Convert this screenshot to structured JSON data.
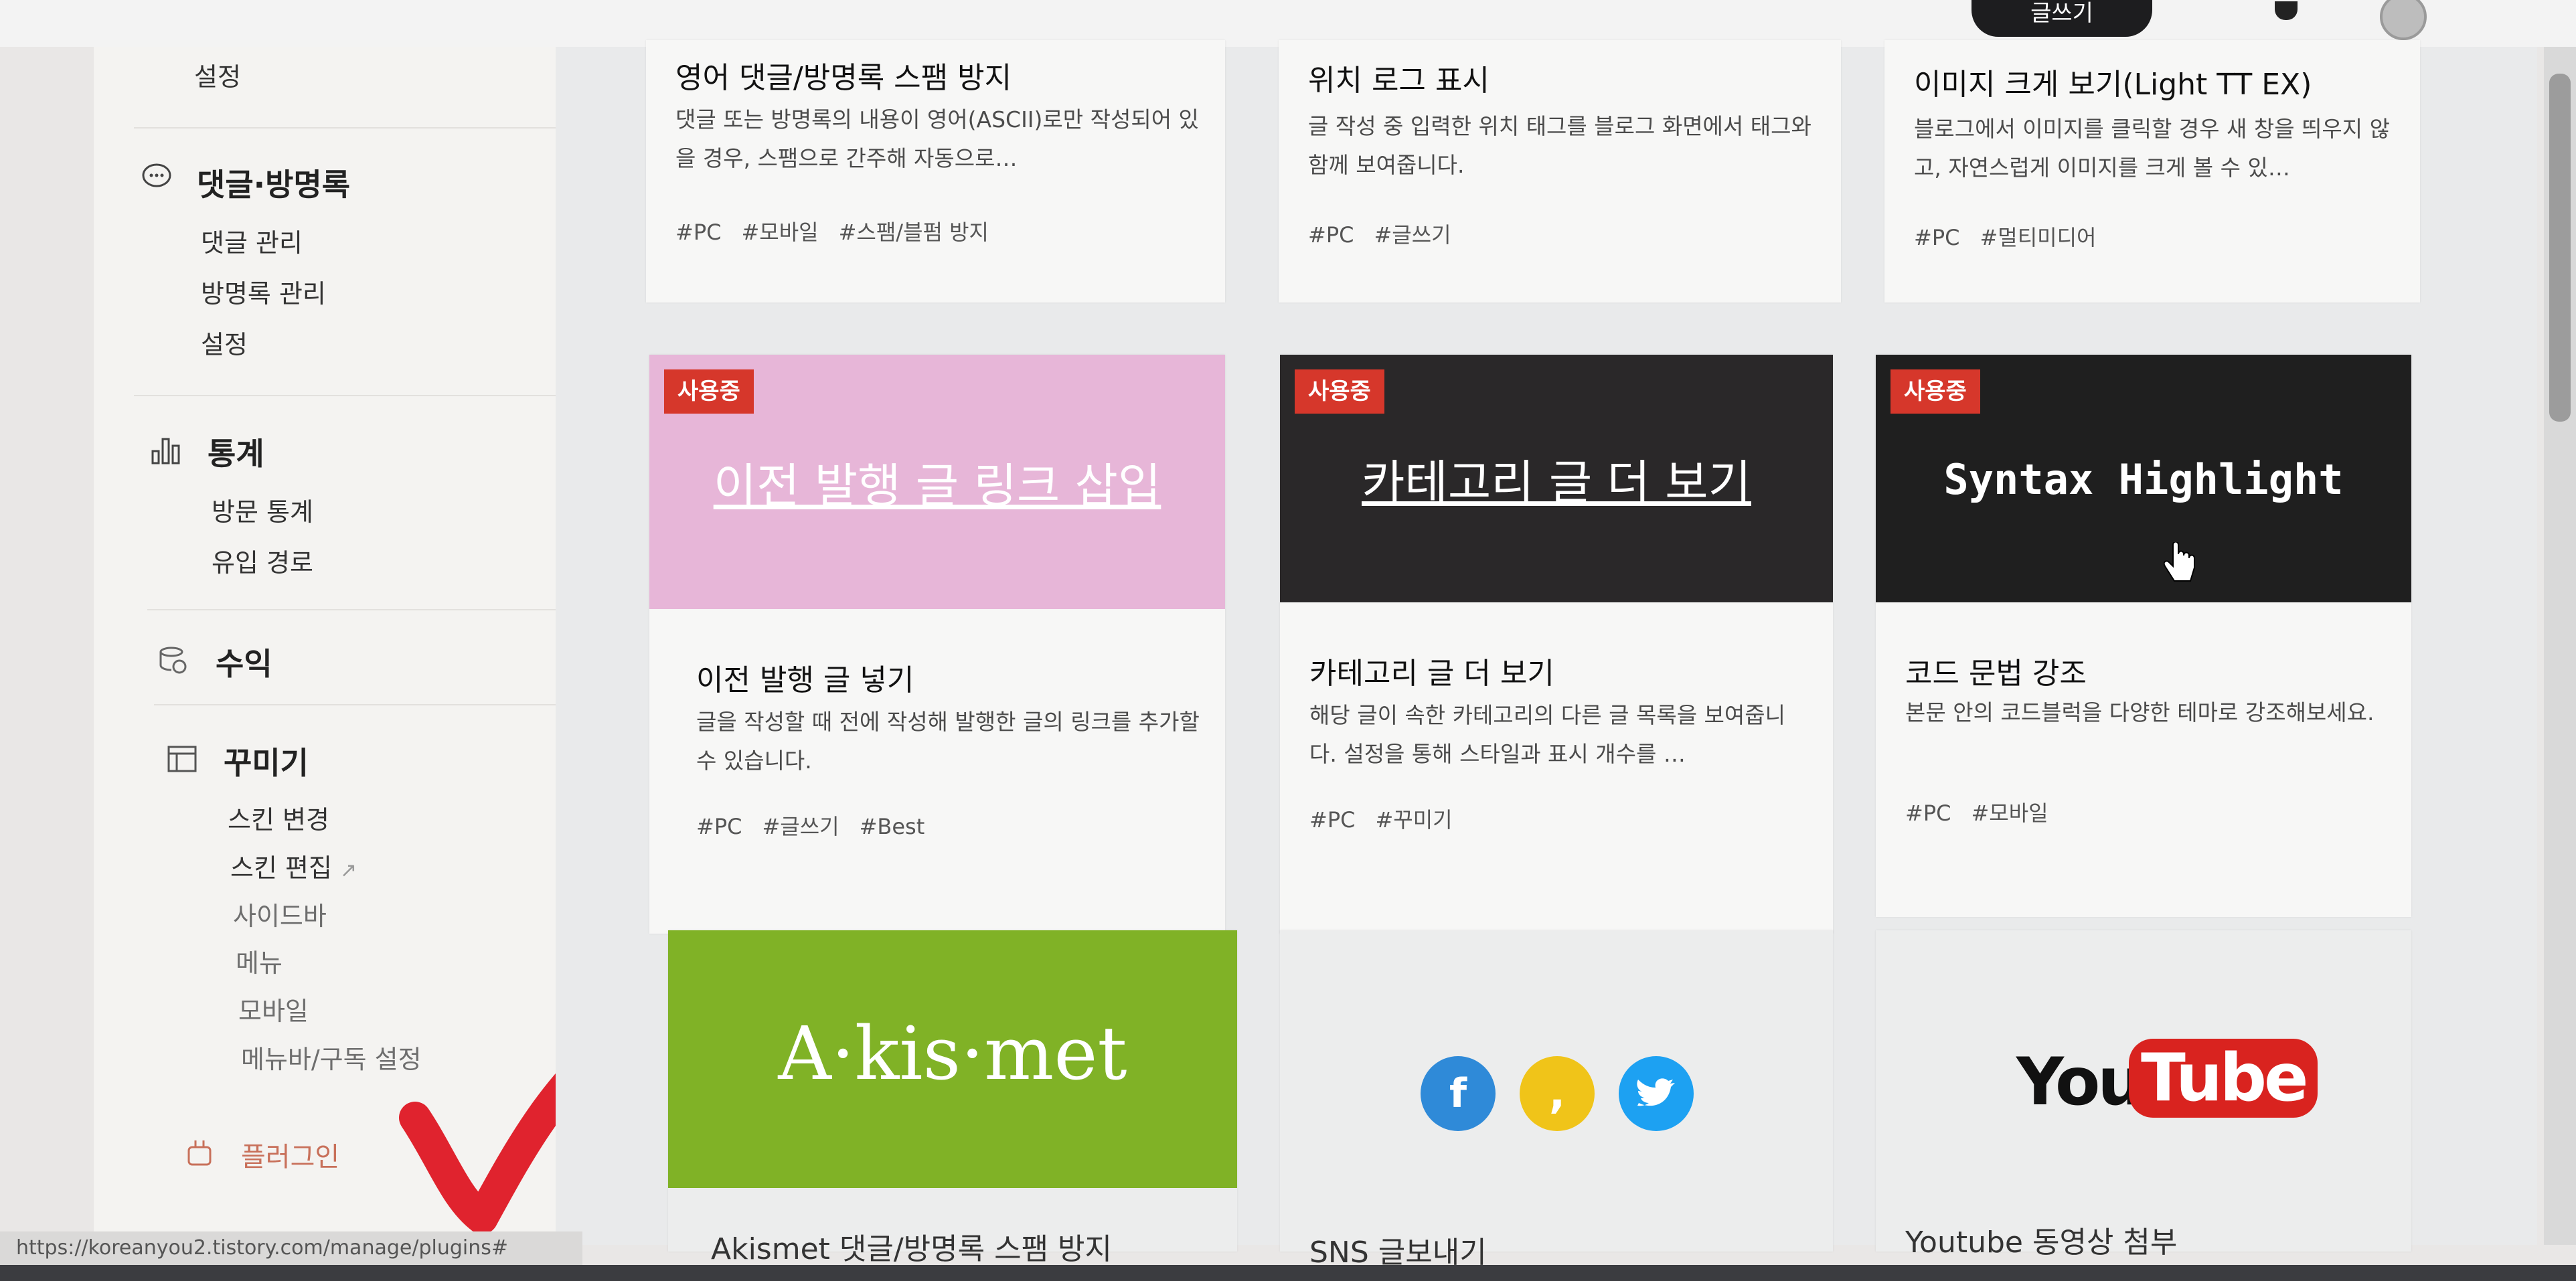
{
  "header": {
    "write_label": "글쓰기"
  },
  "sidebar": {
    "top_item": "설정",
    "sections": [
      {
        "title": "댓글·방명록",
        "items": [
          "댓글 관리",
          "방명록 관리",
          "설정"
        ]
      },
      {
        "title": "통계",
        "items": [
          "방문 통계",
          "유입 경로"
        ]
      },
      {
        "title": "수익",
        "items": []
      },
      {
        "title": "꾸미기",
        "items": [
          "스킨 변경",
          "스킨 편집",
          "사이드바",
          "메뉴",
          "모바일",
          "메뉴바/구독 설정"
        ]
      }
    ],
    "plugin_label": "플러그인"
  },
  "cards_row1": [
    {
      "title": "영어 댓글/방명록 스팸 방지",
      "desc": "댓글 또는 방명록의 내용이 영어(ASCII)로만 작성되어 있을 경우, 스팸으로 간주해 자동으로…",
      "tags": [
        "#PC",
        "#모바일",
        "#스팸/블펌 방지"
      ]
    },
    {
      "title": "위치 로그 표시",
      "desc": "글 작성 중 입력한 위치 태그를 블로그 화면에서 태그와 함께 보여줍니다.",
      "tags": [
        "#PC",
        "#글쓰기"
      ]
    },
    {
      "title": "이미지 크게 보기(Light TT EX)",
      "desc": "블로그에서 이미지를 클릭할 경우 새 창을 띄우지 않고, 자연스럽게 이미지를 크게 볼 수 있…",
      "tags": [
        "#PC",
        "#멀티미디어"
      ]
    }
  ],
  "cards_row2": [
    {
      "badge": "사용중",
      "thumb_text": "이전 발행 글 링크 삽입",
      "title": "이전 발행 글 넣기",
      "desc": "글을 작성할 때 전에 작성해 발행한 글의 링크를 추가할 수 있습니다.",
      "tags": [
        "#PC",
        "#글쓰기",
        "#Best"
      ],
      "thumb_color": "#e7b6d8"
    },
    {
      "badge": "사용중",
      "thumb_text": "카테고리 글 더 보기",
      "title": "카테고리 글 더 보기",
      "desc": "해당 글이 속한 카테고리의 다른 글 목록을 보여줍니다. 설정을 통해 스타일과 표시 개수를 …",
      "tags": [
        "#PC",
        "#꾸미기"
      ],
      "thumb_color": "#2a2829"
    },
    {
      "badge": "사용중",
      "thumb_text": "Syntax Highlight",
      "title": "코드 문법 강조",
      "desc": "본문 안의 코드블럭을 다양한 테마로 강조해보세요.",
      "tags": [
        "#PC",
        "#모바일"
      ],
      "thumb_color": "#1f1f1f"
    }
  ],
  "cards_row3": [
    {
      "logo_text": "A·kis·met",
      "title": "Akismet 댓글/방명록 스팸 방지",
      "thumb_color": "#80b226"
    },
    {
      "title": "SNS 글보내기",
      "icon_colors": [
        "#2f8ad8",
        "#f0c419",
        "#1da1f2"
      ]
    },
    {
      "logo_text_you": "You",
      "logo_text_tube": "Tube",
      "title": "Youtube 동영상 첨부"
    }
  ],
  "status_url": "https://koreanyou2.tistory.com/manage/plugins#"
}
